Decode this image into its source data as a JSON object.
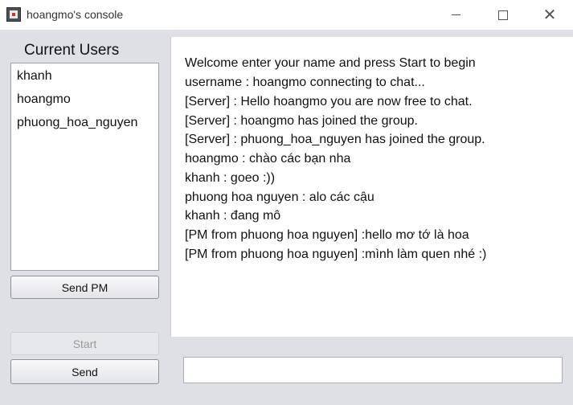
{
  "window": {
    "title": "hoangmo's console"
  },
  "users": {
    "title": "Current Users",
    "items": [
      "khanh",
      "hoangmo",
      "phuong_hoa_nguyen"
    ]
  },
  "buttons": {
    "send_pm": "Send PM",
    "start": "Start",
    "send": "Send"
  },
  "chat": {
    "lines": [
      "Welcome enter your name and press Start to begin",
      "username : hoangmo connecting to chat...",
      "[Server] : Hello hoangmo you are now free to chat.",
      "[Server] : hoangmo has joined the group.",
      "[Server] : phuong_hoa_nguyen has joined the group.",
      "hoangmo : chào các bạn nha",
      "khanh : goeo :))",
      "phuong hoa nguyen : alo các cậu",
      "khanh : đang mô",
      "[PM from phuong hoa nguyen] :hello mơ tớ là hoa",
      "[PM from phuong hoa nguyen] :mình làm quen nhé :)"
    ]
  },
  "input": {
    "value": ""
  },
  "icons": {
    "app": "java-app-icon",
    "minimize": "minimize-icon",
    "maximize": "maximize-icon",
    "close": "close-icon"
  }
}
